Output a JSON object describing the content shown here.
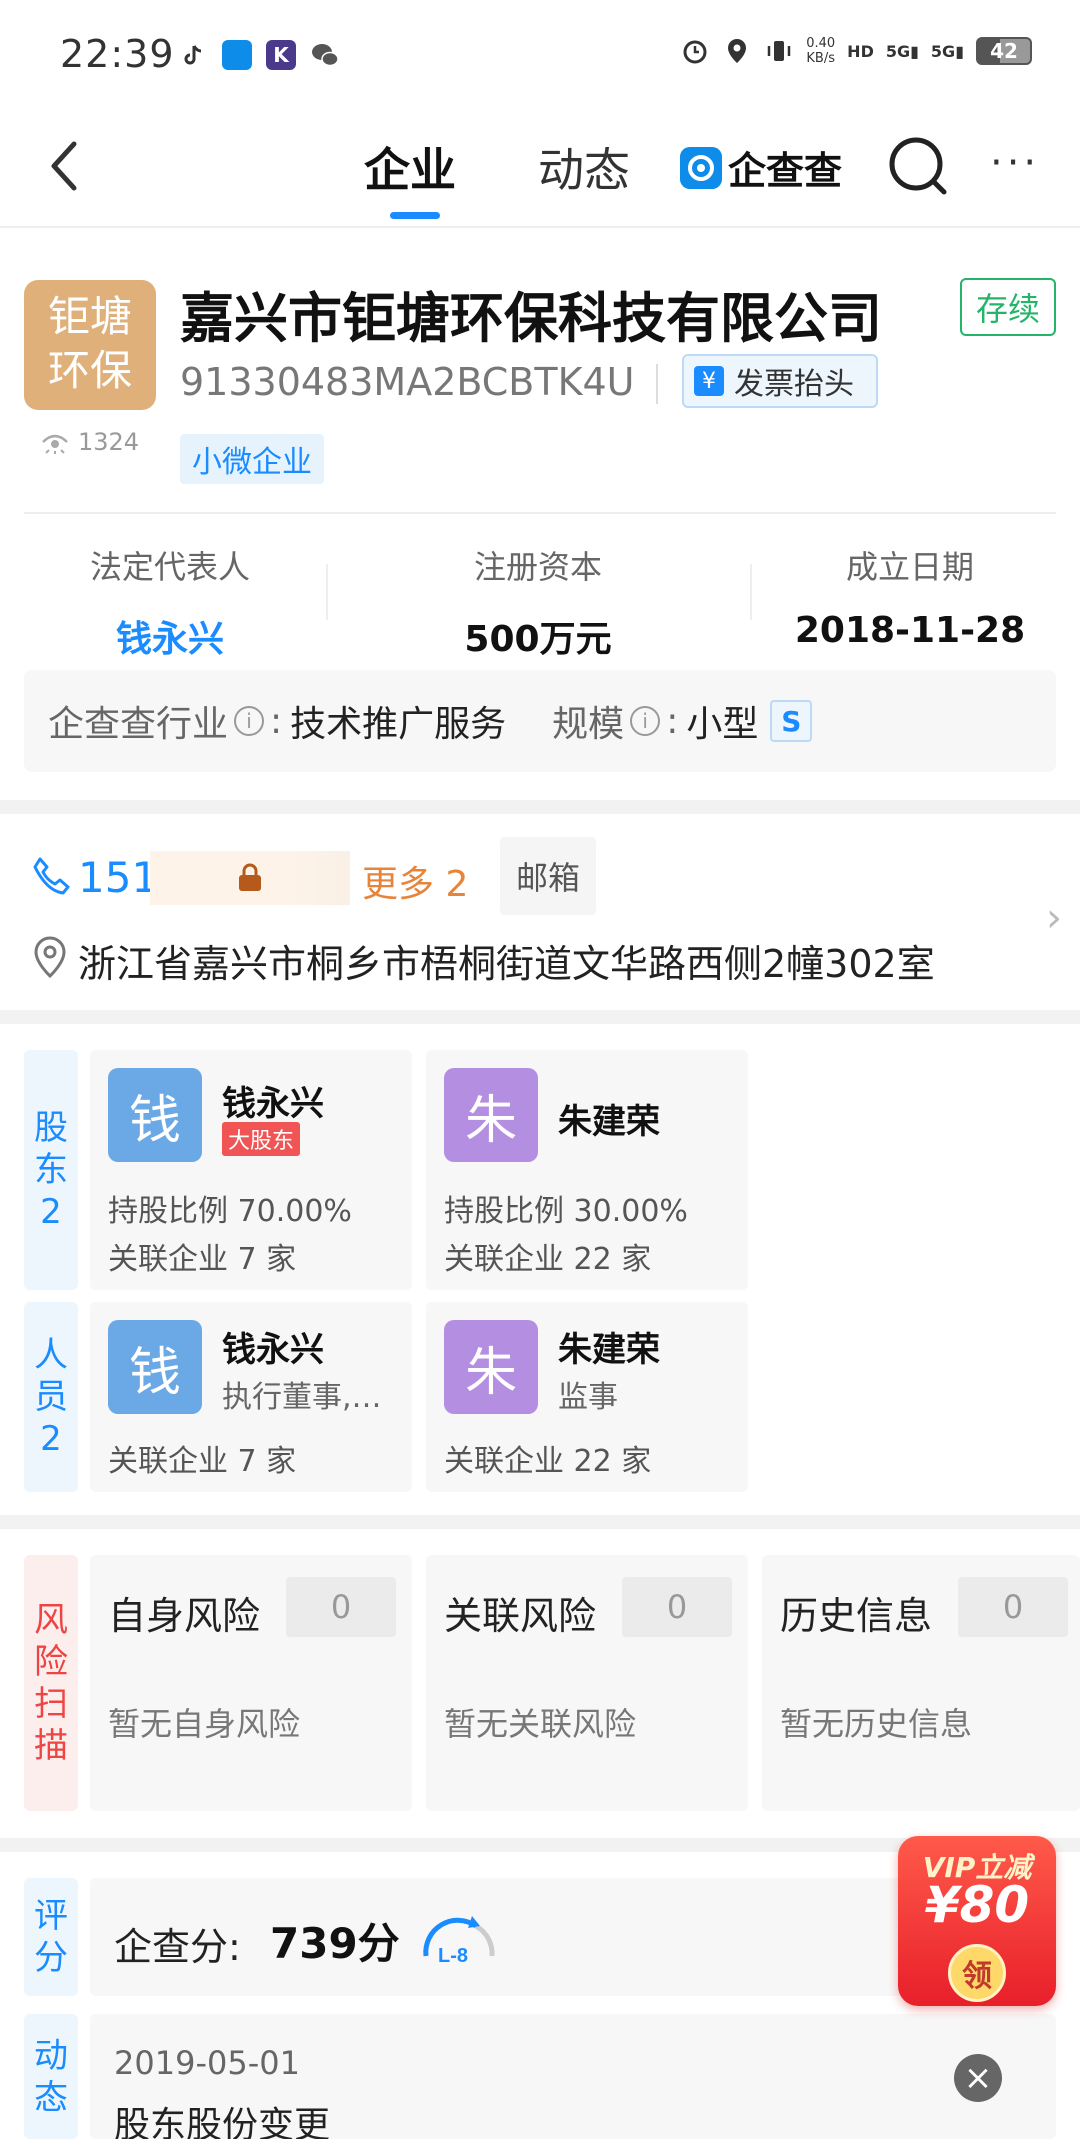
{
  "status_bar": {
    "time": "22:39",
    "net_speed_value": "0.40",
    "net_speed_unit": "KB/s",
    "hd_label": "HD",
    "sim1": "5G",
    "sim2": "5G",
    "battery": "42"
  },
  "nav": {
    "tabs": [
      {
        "label": "企业",
        "active": true
      },
      {
        "label": "动态",
        "active": false
      }
    ],
    "brand": "企查查",
    "more": "···"
  },
  "company": {
    "logo_line1": "钜塘",
    "logo_line2": "环保",
    "views": "1324",
    "name": "嘉兴市钜塘环保科技有限公司",
    "status": "存续",
    "credit_code": "91330483MA2BCBTK4U",
    "invoice_label": "发票抬头",
    "invoice_icon": "¥",
    "tag": "小微企业",
    "legal_rep_label": "法定代表人",
    "legal_rep": "钱永兴",
    "capital_label": "注册资本",
    "capital": "500万元",
    "founded_label": "成立日期",
    "founded": "2018-11-28",
    "industry_label": "企查查行业",
    "industry_sep": ":",
    "industry": "技术推广服务",
    "scale_label": "规模",
    "scale": "小型",
    "scale_badge": "S"
  },
  "contact": {
    "phone_prefix": "151",
    "more_label": "更多 2",
    "email_label": "邮箱",
    "address": "浙江省嘉兴市桐乡市梧桐街道文华路西侧2幢302室"
  },
  "shareholders": {
    "side_label": [
      "股",
      "东",
      "2"
    ],
    "items": [
      {
        "avatar": "钱",
        "name": "钱永兴",
        "badge": "大股东",
        "ratio": "持股比例 70.00%",
        "related": "关联企业 7 家"
      },
      {
        "avatar": "朱",
        "name": "朱建荣",
        "ratio": "持股比例 30.00%",
        "related": "关联企业 22 家"
      }
    ]
  },
  "personnel": {
    "side_label": [
      "人",
      "员",
      "2"
    ],
    "items": [
      {
        "avatar": "钱",
        "name": "钱永兴",
        "role": "执行董事,…",
        "related": "关联企业 7 家"
      },
      {
        "avatar": "朱",
        "name": "朱建荣",
        "role": "监事",
        "related": "关联企业 22 家"
      }
    ]
  },
  "risk": {
    "side_label": [
      "风",
      "险",
      "扫",
      "描"
    ],
    "items": [
      {
        "title": "自身风险",
        "count": "0",
        "desc": "暂无自身风险"
      },
      {
        "title": "关联风险",
        "count": "0",
        "desc": "暂无关联风险"
      },
      {
        "title": "历史信息",
        "count": "0",
        "desc": "暂无历史信息"
      }
    ]
  },
  "score": {
    "side_label": [
      "评",
      "分"
    ],
    "label": "企查分:",
    "value": "739分",
    "level": "L-8"
  },
  "dynamic": {
    "side_label": [
      "动",
      "态"
    ],
    "date": "2019-05-01",
    "text": "股东股份变更"
  },
  "vip": {
    "title": "VIP立减",
    "amount": "¥80",
    "button": "领"
  },
  "colors": {
    "accent": "#1a8cff",
    "status_green": "#26b46a",
    "logo_bg": "#e0b07a",
    "risk_red": "#e44444",
    "orange": "#e8843a"
  }
}
